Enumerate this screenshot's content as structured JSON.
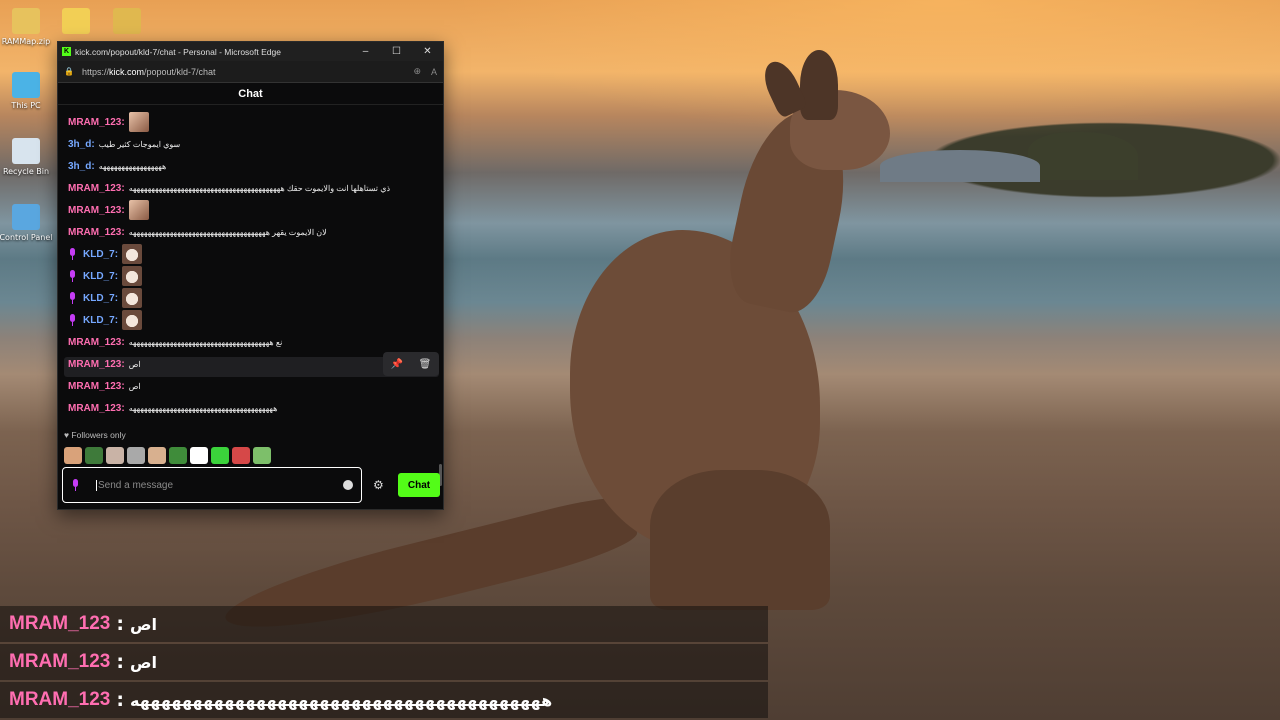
{
  "desktop": {
    "icons": [
      {
        "label": "RAMMap.zip",
        "color": "#e7c25d"
      },
      {
        "label": "",
        "color": "#f2cf55"
      },
      {
        "label": "",
        "color": "#e0b84f"
      },
      {
        "label": "This PC",
        "color": "#4bb3e6"
      },
      {
        "label": "Recycle Bin",
        "color": "#d8e4ee"
      },
      {
        "label": "Control Panel",
        "color": "#5aa7e0"
      }
    ]
  },
  "window": {
    "title": "kick.com/popout/kld-7/chat - Personal - Microsoft Edge",
    "kick_letter": "K",
    "url_prefix": "https://",
    "url_domain": "kick.com",
    "url_path": "/popout/kld-7/chat",
    "minimize": "–",
    "maximize": "☐",
    "close": "✕"
  },
  "chat": {
    "header": "Chat",
    "messages": [
      {
        "user": "MRAM_123",
        "color": "pink",
        "text": "",
        "emote": "photo",
        "mic": false
      },
      {
        "user": "3h_d",
        "color": "blue",
        "text": "سوي ايموجات كثير طيب",
        "emote": "",
        "mic": false
      },
      {
        "user": "3h_d",
        "color": "blue",
        "text": "هههههههههههههههههه",
        "emote": "",
        "mic": false
      },
      {
        "user": "MRAM_123",
        "color": "pink",
        "text": "ذي تستاهلها انت والايموت حقك هههههههههههههههههههههههههههههههههههههههههه",
        "emote": "",
        "mic": false
      },
      {
        "user": "MRAM_123",
        "color": "pink",
        "text": "",
        "emote": "photo",
        "mic": false
      },
      {
        "user": "MRAM_123",
        "color": "pink",
        "text": "لان الايموت يقهر هههههههههههههههههههههههههههههههههههههه",
        "emote": "",
        "mic": false
      },
      {
        "user": "KLD_7",
        "color": "blue",
        "text": "",
        "emote": "cat",
        "mic": true
      },
      {
        "user": "KLD_7",
        "color": "blue",
        "text": "",
        "emote": "cat",
        "mic": true
      },
      {
        "user": "KLD_7",
        "color": "blue",
        "text": "",
        "emote": "cat",
        "mic": true
      },
      {
        "user": "KLD_7",
        "color": "blue",
        "text": "",
        "emote": "cat",
        "mic": true
      },
      {
        "user": "MRAM_123",
        "color": "pink",
        "text": "نع ههههههههههههههههههههههههههههههههههههههه",
        "emote": "",
        "mic": false
      },
      {
        "user": "MRAM_123",
        "color": "pink",
        "text": "اص",
        "emote": "",
        "mic": false
      },
      {
        "user": "MRAM_123",
        "color": "pink",
        "text": "اص",
        "emote": "",
        "mic": false
      },
      {
        "user": "MRAM_123",
        "color": "pink",
        "text": "هههههههههههههههههههههههههههههههههههههههه",
        "emote": "",
        "mic": false
      }
    ],
    "hover_actions": {
      "pin": "📌",
      "delete": "🗑"
    },
    "followers_only": "Followers only",
    "heart": "♥",
    "emote_bar": [
      "#d9a27a",
      "#3e7a3a",
      "#c9b3a6",
      "#a9a9a9",
      "#d8b08f",
      "#3f8c3a",
      "#ffffff",
      "#3bd33b",
      "#d64848",
      "#7dbf6a"
    ],
    "input_placeholder": "Send a message",
    "send_label": "Chat",
    "gear": "⚙"
  },
  "overlay": [
    {
      "user": "MRAM_123",
      "sep": ":",
      "text": "اص"
    },
    {
      "user": "MRAM_123",
      "sep": ":",
      "text": "اص"
    },
    {
      "user": "MRAM_123",
      "sep": ":",
      "text": "هههههههههههههههههههههههههههههههههههههههه"
    }
  ],
  "colors": {
    "kick_green": "#53fc18",
    "user_pink": "#ff6eb1",
    "user_blue": "#76a8ff"
  }
}
